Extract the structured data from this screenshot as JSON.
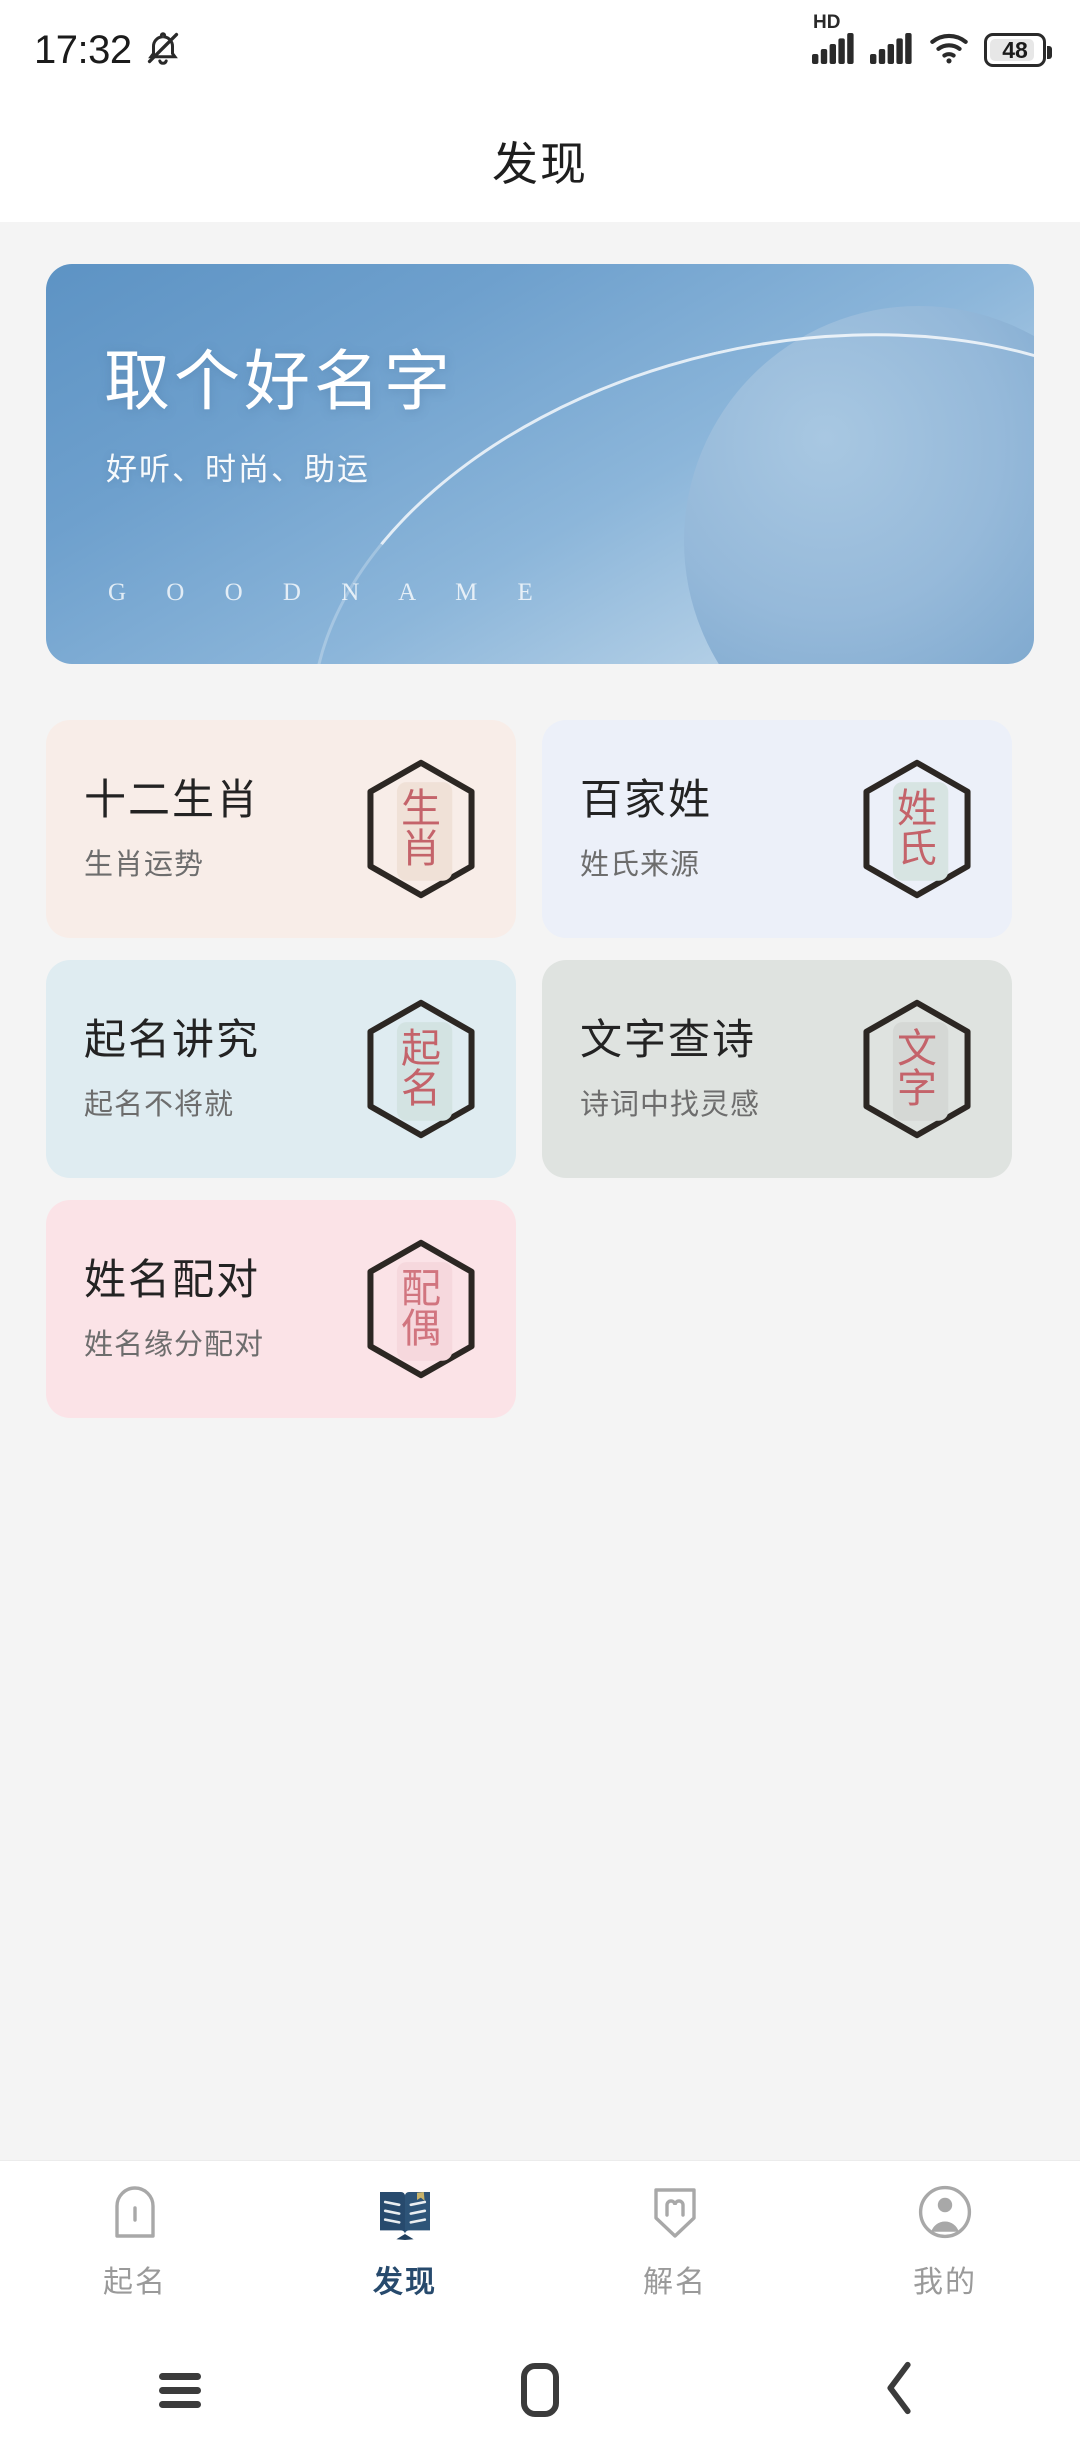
{
  "statusbar": {
    "time": "17:32",
    "mute_icon": "bell-muted-icon",
    "hd_label": "HD",
    "signal1_icon": "signal-bars-icon",
    "signal2_icon": "signal-bars-icon",
    "wifi_icon": "wifi-icon",
    "battery_level": "48"
  },
  "header": {
    "title": "发现"
  },
  "banner": {
    "title": "取个好名字",
    "subtitle": "好听、时尚、助运",
    "english": "G O O D   N A M E",
    "planet_icon": "planet-sphere-decoration",
    "arc_icon": "orbit-arc-decoration"
  },
  "cards": [
    {
      "title": "十二生肖",
      "subtitle": "生肖运势",
      "seal_top": "生",
      "seal_bottom": "肖",
      "bg": "#f8ede8",
      "inner": "#f0e1d7",
      "glyph_color": "#c4636a",
      "icon": "seal-stamp-icon"
    },
    {
      "title": "百家姓",
      "subtitle": "姓氏来源",
      "seal_top": "姓",
      "seal_bottom": "氏",
      "bg": "#ecf0f9",
      "inner": "#d7e4e2",
      "glyph_color": "#c4636a",
      "icon": "seal-stamp-icon"
    },
    {
      "title": "起名讲究",
      "subtitle": "起名不将就",
      "seal_top": "起",
      "seal_bottom": "名",
      "bg": "#dfecf1",
      "inner": "#d3e3e2",
      "glyph_color": "#c4636a",
      "icon": "seal-stamp-icon"
    },
    {
      "title": "文字查诗",
      "subtitle": "诗词中找灵感",
      "seal_top": "文",
      "seal_bottom": "字",
      "bg": "#dfe3e0",
      "inner": "#d5d8d5",
      "glyph_color": "#c4636a",
      "icon": "seal-stamp-icon"
    },
    {
      "title": "姓名配对",
      "subtitle": "姓名缘分配对",
      "seal_top": "配",
      "seal_bottom": "偶",
      "bg": "#fbe3e7",
      "inner": "#f6d8dd",
      "glyph_color": "#d1757f",
      "icon": "seal-stamp-icon"
    }
  ],
  "tabbar": {
    "active_color": "#274a6d",
    "items": [
      {
        "label": "起名",
        "icon": "name-tag-outline-icon",
        "active": false
      },
      {
        "label": "发现",
        "icon": "open-book-icon",
        "active": true
      },
      {
        "label": "解名",
        "icon": "pentagon-m-icon",
        "active": false
      },
      {
        "label": "我的",
        "icon": "user-circle-icon",
        "active": false
      }
    ]
  },
  "navbar": {
    "recents_icon": "menu-recents-icon",
    "home_icon": "home-square-icon",
    "back_icon": "chevron-back-icon"
  }
}
